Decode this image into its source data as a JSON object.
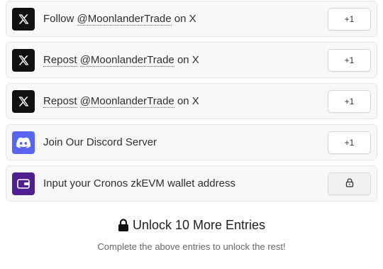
{
  "entries": [
    {
      "label_prefix": "Follow ",
      "link_text": "@MoonlanderTrade",
      "label_suffix": " on X",
      "icon": "x-logo-icon",
      "action_label": "+1"
    },
    {
      "label_prefix": "",
      "link_text": "Repost",
      "label_middle": " ",
      "link_text_2": "@MoonlanderTrade",
      "label_suffix": " on X",
      "icon": "x-logo-icon",
      "action_label": "+1"
    },
    {
      "label_prefix": "",
      "link_text": "Repost",
      "label_middle": " ",
      "link_text_2": "@MoonlanderTrade",
      "label_suffix": " on X",
      "icon": "x-logo-icon",
      "action_label": "+1"
    },
    {
      "label": "Join Our Discord Server",
      "icon": "discord-icon",
      "action_label": "+1"
    },
    {
      "label": "Input your Cronos zkEVM wallet address",
      "icon": "wallet-icon",
      "action_icon": "lock-icon"
    }
  ],
  "unlock": {
    "title": "Unlock 10 More Entries",
    "subtitle": "Complete the above entries to unlock the rest!"
  },
  "colors": {
    "x_bg": "#111111",
    "discord_bg": "#5865f2",
    "wallet_bg": "#4d1f8f"
  }
}
